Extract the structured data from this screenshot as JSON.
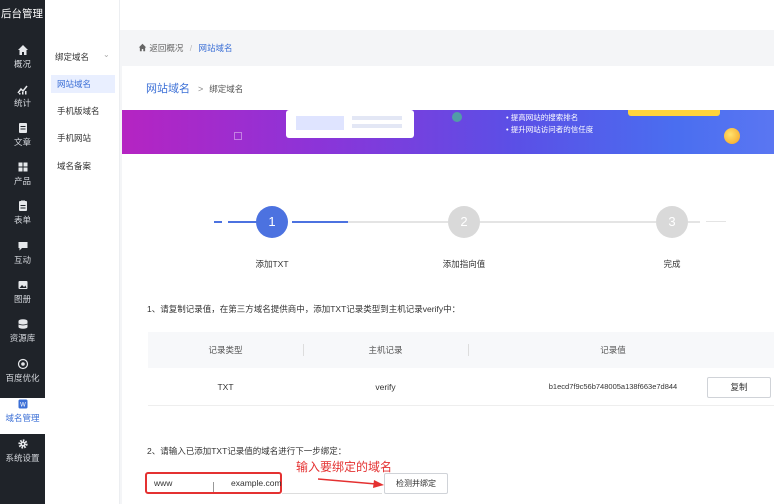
{
  "app": {
    "title": "后台管理"
  },
  "sidebar": {
    "items": [
      {
        "label": "概况",
        "icon": "home-icon"
      },
      {
        "label": "统计",
        "icon": "chart-icon"
      },
      {
        "label": "文章",
        "icon": "document-icon"
      },
      {
        "label": "产品",
        "icon": "grid-icon"
      },
      {
        "label": "表单",
        "icon": "form-icon"
      },
      {
        "label": "互动",
        "icon": "chat-icon"
      },
      {
        "label": "图册",
        "icon": "image-icon"
      },
      {
        "label": "资源库",
        "icon": "database-icon"
      },
      {
        "label": "百度优化",
        "icon": "seo-icon"
      },
      {
        "label": "域名管理",
        "icon": "domain-icon",
        "active": true
      },
      {
        "label": "系统设置",
        "icon": "gear-icon"
      }
    ]
  },
  "submenu": {
    "title": "绑定域名",
    "items": [
      {
        "label": "网站域名",
        "active": true
      },
      {
        "label": "手机版域名"
      },
      {
        "label": "手机网站"
      },
      {
        "label": "域名备案"
      }
    ]
  },
  "breadcrumb": {
    "home": "返回概况",
    "separator": "/",
    "current": "网站域名"
  },
  "panel": {
    "title": "网站域名",
    "subtitle": "绑定域名",
    "banner": {
      "line1": "• 提高网站的搜索排名",
      "line2": "• 提升网站访问者的信任度"
    }
  },
  "steps": [
    {
      "num": "1",
      "label": "添加TXT",
      "active": true
    },
    {
      "num": "2",
      "label": "添加指向值",
      "active": false
    },
    {
      "num": "3",
      "label": "完成",
      "active": false
    }
  ],
  "instruction1": "1、请复制记录值，在第三方域名提供商中，添加TXT记录类型到主机记录verify中：",
  "table": {
    "headers": [
      "记录类型",
      "主机记录",
      "记录值"
    ],
    "rows": [
      {
        "type": "TXT",
        "host": "verify",
        "value": "b1ecd7f9c56b748005a138f663e7d844",
        "action": "复制"
      }
    ]
  },
  "instruction2": "2、请输入已添加TXT记录值的域名进行下一步绑定：",
  "domain_input": {
    "prefix": "www",
    "value": "example.com"
  },
  "detect_button": "检测并绑定",
  "annotation": "输入要绑定的域名",
  "colors": {
    "accent": "#3b6fd6",
    "sidebar": "#1f2329",
    "highlight": "#e43131"
  }
}
